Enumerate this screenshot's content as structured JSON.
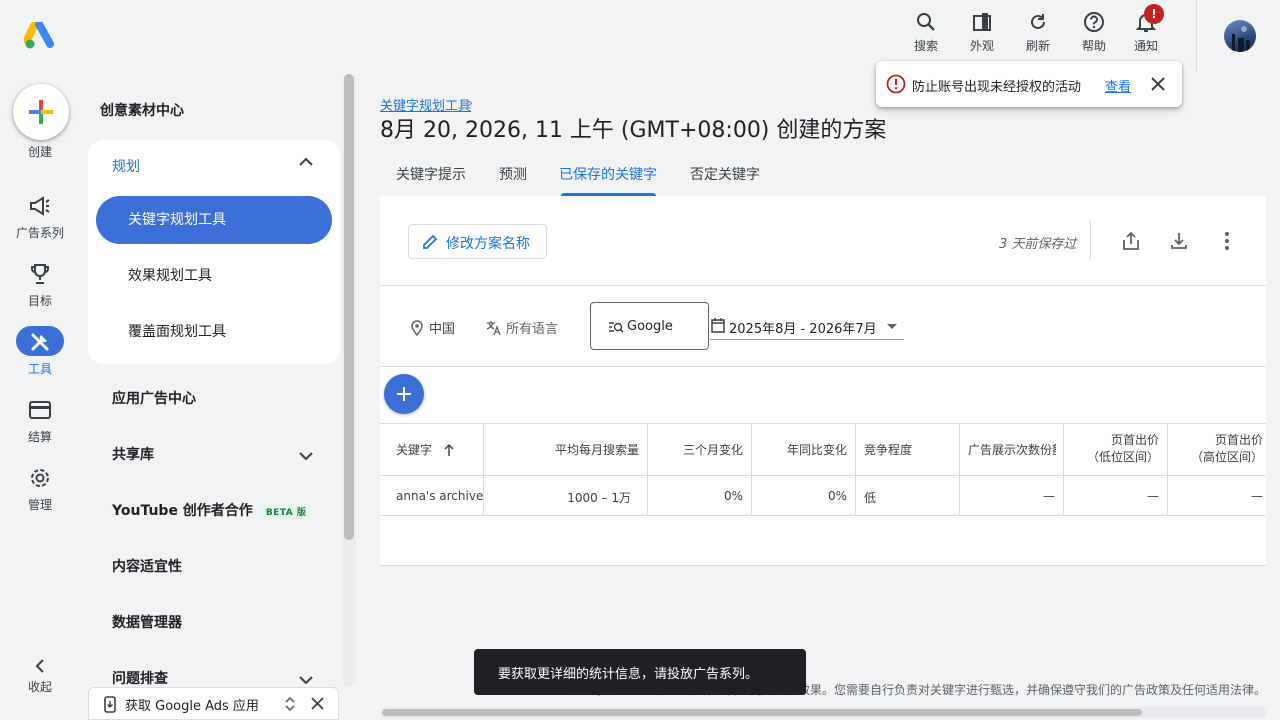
{
  "rail": {
    "create_label": "创建",
    "items": [
      {
        "label": "广告系列",
        "icon": "megaphone-icon"
      },
      {
        "label": "目标",
        "icon": "trophy-icon"
      },
      {
        "label": "工具",
        "icon": "tools-icon"
      },
      {
        "label": "结算",
        "icon": "credit-card-icon"
      },
      {
        "label": "管理",
        "icon": "gear-icon"
      }
    ],
    "collapse_label": "收起"
  },
  "sidenav": {
    "creative_center": "创意素材中心",
    "planning": {
      "label": "规划",
      "items": [
        "关键字规划工具",
        "效果规划工具",
        "覆盖面规划工具"
      ],
      "selected": "关键字规划工具"
    },
    "app_ads_center": "应用广告中心",
    "shared_library": "共享库",
    "youtube_collab": "YouTube 创作者合作",
    "beta_label": "BETA 版",
    "content_suitability": "内容适宜性",
    "data_manager": "数据管理器",
    "troubleshooting": "问题排查",
    "app_banner": "获取 Google Ads 应用"
  },
  "topbar": {
    "search": "搜索",
    "appearance": "外观",
    "refresh": "刷新",
    "help": "帮助",
    "notifications": "通知",
    "notification_badge": "!"
  },
  "main": {
    "breadcrumb": "关键字规划工具",
    "title": "8月 20, 2026, 11 上午 (GMT+08:00) 创建的方案",
    "tabs": [
      "关键字提示",
      "预测",
      "已保存的关键字",
      "否定关键字"
    ],
    "active_tab": "已保存的关键字",
    "rename_label": "修改方案名称",
    "saved_text": "3 天前保存过",
    "filters": {
      "location": "中国",
      "language": "所有语言",
      "network": "Google",
      "date_range": "2025年8月 - 2026年7月"
    },
    "table": {
      "headers": [
        "关键字",
        "平均每月搜索量",
        "三个月变化",
        "年同比变化",
        "竞争程度",
        "广告展示次数份额",
        "页首出价",
        "页首出价"
      ],
      "header_sub": [
        "",
        "",
        "",
        "",
        "",
        "",
        "（低位区间）",
        "（高位区间）"
      ],
      "rows": [
        {
          "keyword": "anna's archive",
          "avg_searches": "1000 – 1万",
          "three_month": "0%",
          "yoy": "0%",
          "competition": "低",
          "impr_share": "—",
          "bid_low": "—",
          "bid_high": "—"
        }
      ]
    }
  },
  "toast": {
    "message": "防止账号出现未经授权的活动",
    "link": "查看"
  },
  "snackbar": "要获取更详细的统计信息，请投放广告系列。",
  "footer": "关键字提示可以帮助您制作广告系列并改善效果。您需要自行负责对关键字进行甄选，并确保遵守我们的广告政策及任何适用法律。"
}
